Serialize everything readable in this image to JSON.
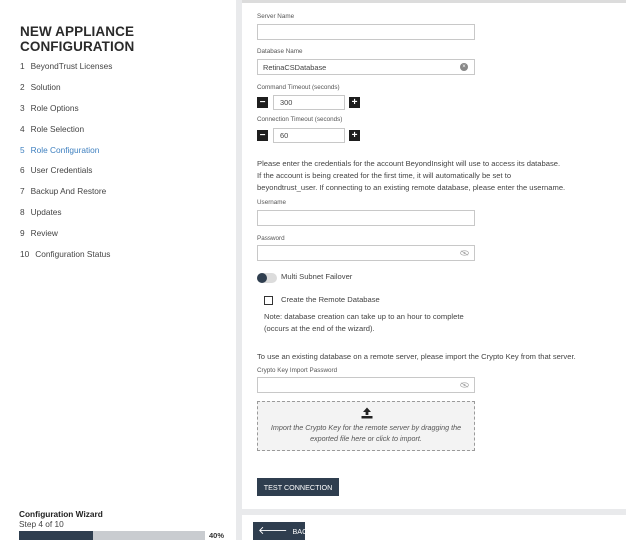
{
  "sidebar": {
    "title": "NEW APPLIANCE CONFIGURATION",
    "steps": [
      {
        "num": "1",
        "label": "BeyondTrust Licenses"
      },
      {
        "num": "2",
        "label": "Solution"
      },
      {
        "num": "3",
        "label": "Role Options"
      },
      {
        "num": "4",
        "label": "Role Selection"
      },
      {
        "num": "5",
        "label": "Role Configuration"
      },
      {
        "num": "6",
        "label": "User Credentials"
      },
      {
        "num": "7",
        "label": "Backup And Restore"
      },
      {
        "num": "8",
        "label": "Updates"
      },
      {
        "num": "9",
        "label": "Review"
      },
      {
        "num": "10",
        "label": "Configuration Status"
      }
    ],
    "active_step": "5",
    "wizard_title": "Configuration Wizard",
    "wizard_step": "Step 4 of 10",
    "progress_percent": 40,
    "progress_label": "40%"
  },
  "form": {
    "server_name_label": "Server Name",
    "server_name_value": "",
    "database_name_label": "Database Name",
    "database_name_value": "RetinaCSDatabase",
    "command_timeout_label": "Command Timeout (seconds)",
    "command_timeout_value": "300",
    "connection_timeout_label": "Connection Timeout (seconds)",
    "connection_timeout_value": "60",
    "credentials_text_1": "Please enter the credentials for the account BeyondInsight will use to access its database.",
    "credentials_text_2": "If the account is being created for the first time, it will automatically be set to",
    "credentials_text_3": "beyondtrust_user. If connecting to an existing remote database, please enter the username.",
    "username_label": "Username",
    "username_value": "",
    "password_label": "Password",
    "password_value": "",
    "multi_subnet_label": "Multi Subnet Failover",
    "multi_subnet_on": false,
    "create_remote_label": "Create the Remote Database",
    "create_remote_checked": false,
    "note_line_1": "Note: database creation can take up to an hour to complete",
    "note_line_2": "(occurs at the end of the wizard).",
    "crypto_text": "To use an existing database on a remote server, please import the Crypto Key from that server.",
    "crypto_label": "Crypto Key Import Password",
    "crypto_value": "",
    "dropzone_line_1": "Import the Crypto Key for the remote server by dragging the",
    "dropzone_line_2": "exported file here or click to import.",
    "test_button": "TEST CONNECTION"
  },
  "footer": {
    "back_label": "BACK"
  },
  "icons": {
    "minus": "minus-icon",
    "plus": "plus-icon",
    "clear": "clear-icon",
    "eye": "eye-slash-icon",
    "upload": "upload-icon",
    "back": "arrow-left-icon"
  },
  "colors": {
    "accent": "#3d7fbf",
    "dark_button": "#2f3e4f",
    "background": "#e9eaec"
  }
}
